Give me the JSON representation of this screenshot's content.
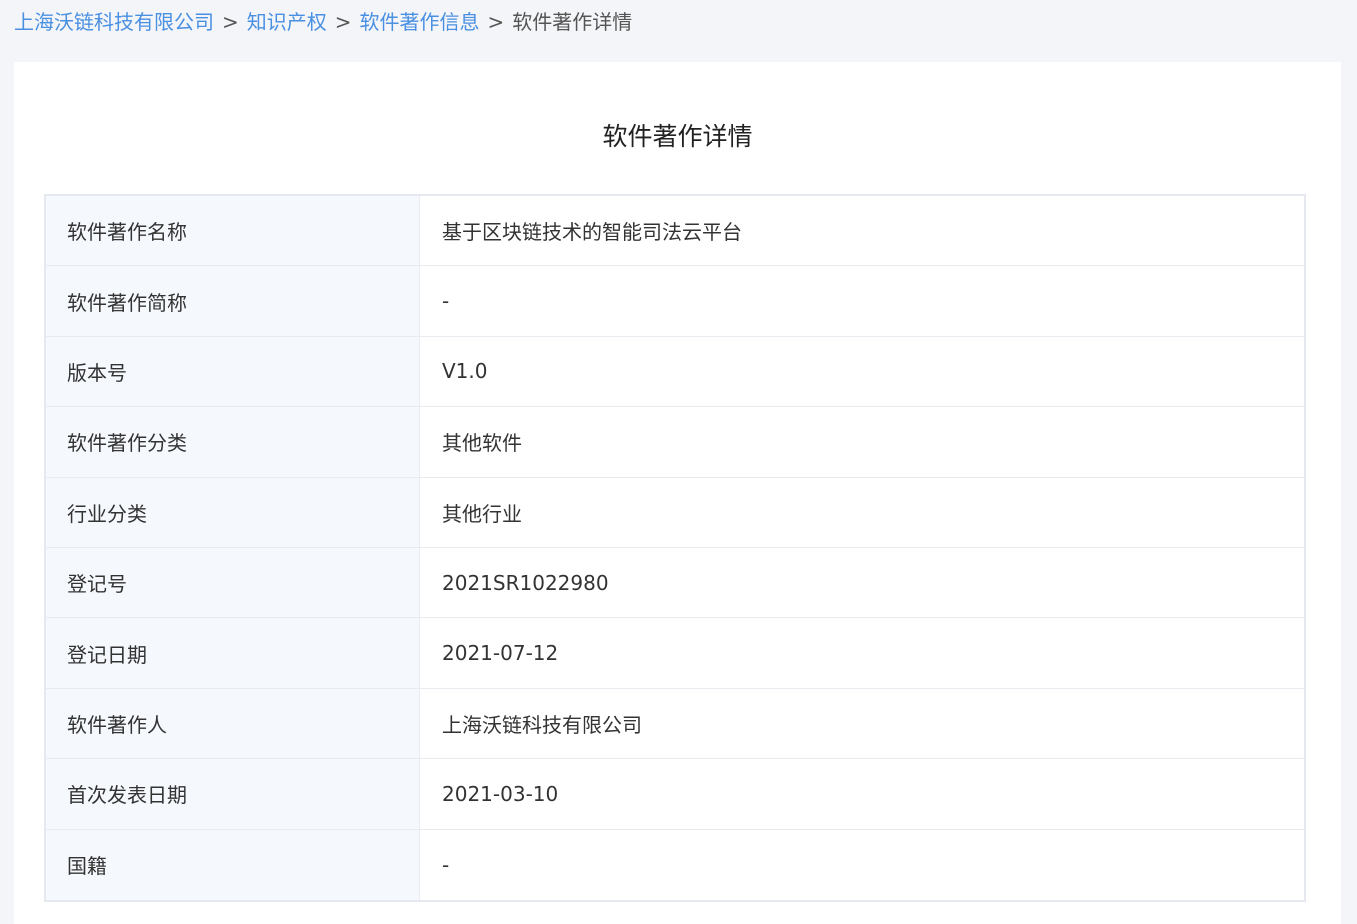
{
  "breadcrumb": {
    "items": [
      "上海沃链科技有限公司",
      "知识产权",
      "软件著作信息"
    ],
    "separator": ">",
    "current": "软件著作详情"
  },
  "page": {
    "title": "软件著作详情"
  },
  "details": [
    {
      "label": "软件著作名称",
      "value": "基于区块链技术的智能司法云平台"
    },
    {
      "label": "软件著作简称",
      "value": "-"
    },
    {
      "label": "版本号",
      "value": "V1.0"
    },
    {
      "label": "软件著作分类",
      "value": "其他软件"
    },
    {
      "label": "行业分类",
      "value": "其他行业"
    },
    {
      "label": "登记号",
      "value": "2021SR1022980"
    },
    {
      "label": "登记日期",
      "value": "2021-07-12"
    },
    {
      "label": "软件著作人",
      "value": "上海沃链科技有限公司"
    },
    {
      "label": "首次发表日期",
      "value": "2021-03-10"
    },
    {
      "label": "国籍",
      "value": "-"
    }
  ],
  "colors": {
    "link": "#4a90e2",
    "label_bg": "#f5f8fd",
    "page_bg": "#f4f5f8"
  }
}
